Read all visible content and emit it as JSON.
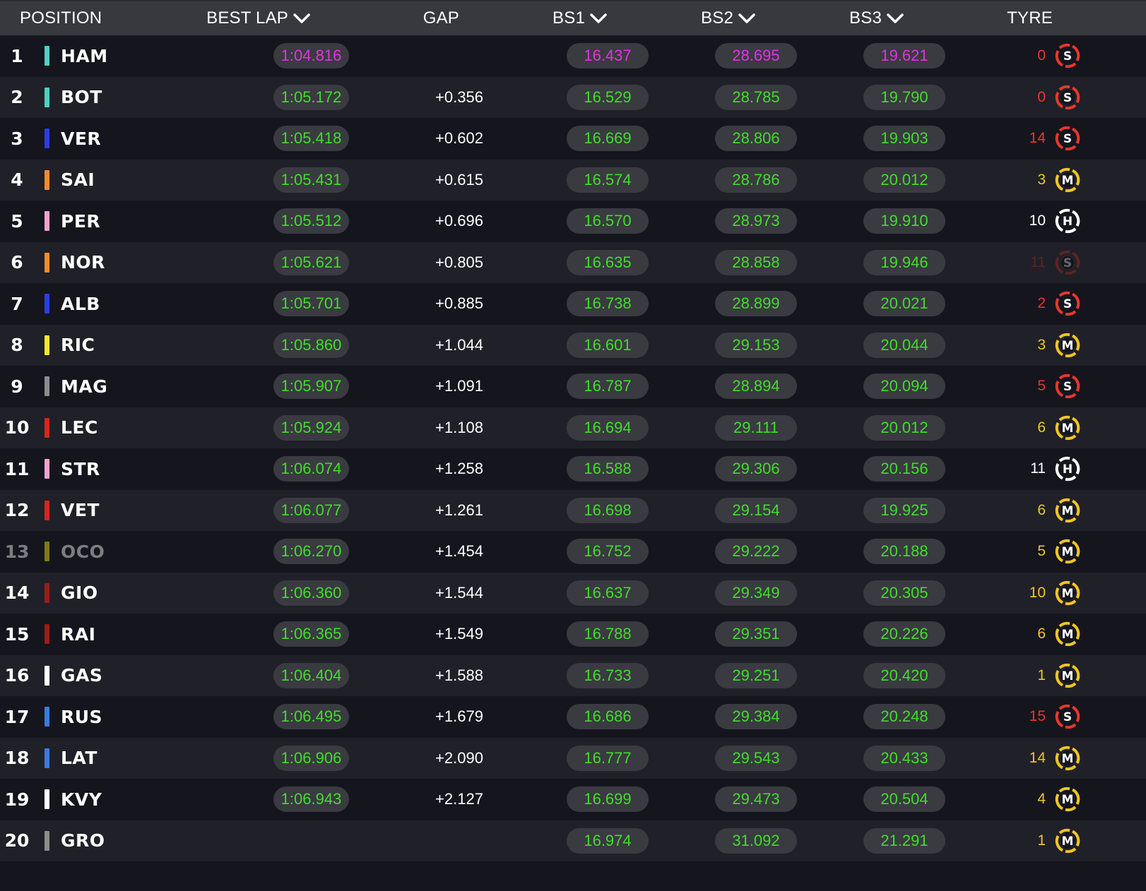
{
  "header": {
    "position": "POSITION",
    "best_lap": "BEST LAP",
    "gap": "GAP",
    "bs1": "BS1",
    "bs2": "BS2",
    "bs3": "BS3",
    "tyre": "TYRE"
  },
  "colors": {
    "green_time": "#41dd2b",
    "purple_time": "#e232e6",
    "soft": "#e6382c",
    "medium": "#f0c623",
    "hard": "#ffffff"
  },
  "rows": [
    {
      "pos": "1",
      "code": "HAM",
      "team_color": "#4ed1c1",
      "best_lap": "1:04.816",
      "best_lap_purple": true,
      "gap": "",
      "bs1": "16.437",
      "bs1_purple": true,
      "bs2": "28.695",
      "bs2_purple": true,
      "bs3": "19.621",
      "bs3_purple": true,
      "laps": "0",
      "tyre": "S",
      "tyre_dim": false
    },
    {
      "pos": "2",
      "code": "BOT",
      "team_color": "#4ed1c1",
      "best_lap": "1:05.172",
      "gap": "+0.356",
      "bs1": "16.529",
      "bs2": "28.785",
      "bs3": "19.790",
      "laps": "0",
      "tyre": "S"
    },
    {
      "pos": "3",
      "code": "VER",
      "team_color": "#2b3de0",
      "best_lap": "1:05.418",
      "gap": "+0.602",
      "bs1": "16.669",
      "bs2": "28.806",
      "bs3": "19.903",
      "laps": "14",
      "tyre": "S"
    },
    {
      "pos": "4",
      "code": "SAI",
      "team_color": "#f58b2c",
      "best_lap": "1:05.431",
      "gap": "+0.615",
      "bs1": "16.574",
      "bs2": "28.786",
      "bs3": "20.012",
      "laps": "3",
      "tyre": "M"
    },
    {
      "pos": "5",
      "code": "PER",
      "team_color": "#f0a3cf",
      "best_lap": "1:05.512",
      "gap": "+0.696",
      "bs1": "16.570",
      "bs2": "28.973",
      "bs3": "19.910",
      "laps": "10",
      "tyre": "H"
    },
    {
      "pos": "6",
      "code": "NOR",
      "team_color": "#f58b2c",
      "best_lap": "1:05.621",
      "gap": "+0.805",
      "bs1": "16.635",
      "bs2": "28.858",
      "bs3": "19.946",
      "laps": "11",
      "tyre": "S",
      "tyre_dim": true
    },
    {
      "pos": "7",
      "code": "ALB",
      "team_color": "#2b3de0",
      "best_lap": "1:05.701",
      "gap": "+0.885",
      "bs1": "16.738",
      "bs2": "28.899",
      "bs3": "20.021",
      "laps": "2",
      "tyre": "S"
    },
    {
      "pos": "8",
      "code": "RIC",
      "team_color": "#f5e72c",
      "best_lap": "1:05.860",
      "gap": "+1.044",
      "bs1": "16.601",
      "bs2": "29.153",
      "bs3": "20.044",
      "laps": "3",
      "tyre": "M"
    },
    {
      "pos": "9",
      "code": "MAG",
      "team_color": "#8c8c8c",
      "best_lap": "1:05.907",
      "gap": "+1.091",
      "bs1": "16.787",
      "bs2": "28.894",
      "bs3": "20.094",
      "laps": "5",
      "tyre": "S"
    },
    {
      "pos": "10",
      "code": "LEC",
      "team_color": "#d6261e",
      "best_lap": "1:05.924",
      "gap": "+1.108",
      "bs1": "16.694",
      "bs2": "29.111",
      "bs3": "20.012",
      "laps": "6",
      "tyre": "M"
    },
    {
      "pos": "11",
      "code": "STR",
      "team_color": "#f0a3cf",
      "best_lap": "1:06.074",
      "gap": "+1.258",
      "bs1": "16.588",
      "bs2": "29.306",
      "bs3": "20.156",
      "laps": "11",
      "tyre": "H"
    },
    {
      "pos": "12",
      "code": "VET",
      "team_color": "#d6261e",
      "best_lap": "1:06.077",
      "gap": "+1.261",
      "bs1": "16.698",
      "bs2": "29.154",
      "bs3": "19.925",
      "laps": "6",
      "tyre": "M"
    },
    {
      "pos": "13",
      "code": "OCO",
      "team_color": "#7d7a16",
      "best_lap": "1:06.270",
      "gap": "+1.454",
      "bs1": "16.752",
      "bs2": "29.222",
      "bs3": "20.188",
      "laps": "5",
      "tyre": "M",
      "dim": true
    },
    {
      "pos": "14",
      "code": "GIO",
      "team_color": "#9b1c1c",
      "best_lap": "1:06.360",
      "gap": "+1.544",
      "bs1": "16.637",
      "bs2": "29.349",
      "bs3": "20.305",
      "laps": "10",
      "tyre": "M"
    },
    {
      "pos": "15",
      "code": "RAI",
      "team_color": "#9b1c1c",
      "best_lap": "1:06.365",
      "gap": "+1.549",
      "bs1": "16.788",
      "bs2": "29.351",
      "bs3": "20.226",
      "laps": "6",
      "tyre": "M"
    },
    {
      "pos": "16",
      "code": "GAS",
      "team_color": "#ffffff",
      "best_lap": "1:06.404",
      "gap": "+1.588",
      "bs1": "16.733",
      "bs2": "29.251",
      "bs3": "20.420",
      "laps": "1",
      "tyre": "M"
    },
    {
      "pos": "17",
      "code": "RUS",
      "team_color": "#3a7ae0",
      "best_lap": "1:06.495",
      "gap": "+1.679",
      "bs1": "16.686",
      "bs2": "29.384",
      "bs3": "20.248",
      "laps": "15",
      "tyre": "S"
    },
    {
      "pos": "18",
      "code": "LAT",
      "team_color": "#3a7ae0",
      "best_lap": "1:06.906",
      "gap": "+2.090",
      "bs1": "16.777",
      "bs2": "29.543",
      "bs3": "20.433",
      "laps": "14",
      "tyre": "M"
    },
    {
      "pos": "19",
      "code": "KVY",
      "team_color": "#ffffff",
      "best_lap": "1:06.943",
      "gap": "+2.127",
      "bs1": "16.699",
      "bs2": "29.473",
      "bs3": "20.504",
      "laps": "4",
      "tyre": "M"
    },
    {
      "pos": "20",
      "code": "GRO",
      "team_color": "#8c8c8c",
      "best_lap": "",
      "gap": "",
      "bs1": "16.974",
      "bs2": "31.092",
      "bs3": "21.291",
      "laps": "1",
      "tyre": "M"
    }
  ]
}
